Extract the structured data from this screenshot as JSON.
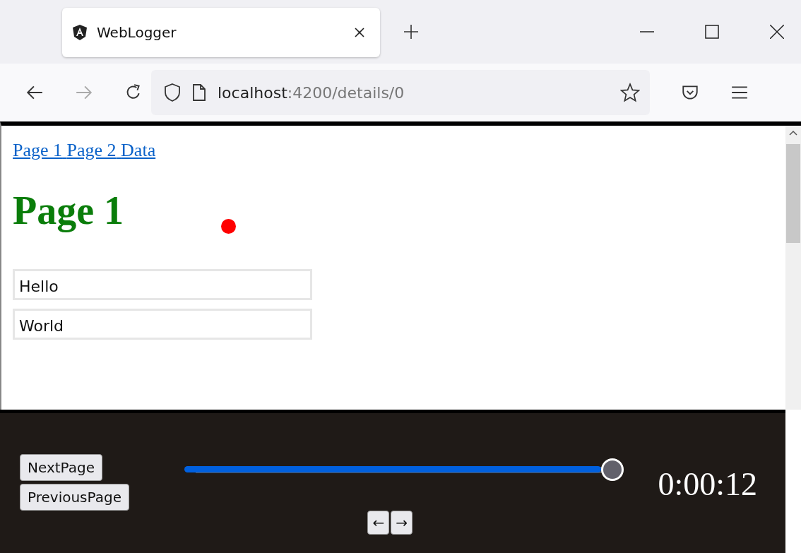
{
  "tab": {
    "title": "WebLogger"
  },
  "address": {
    "host": "localhost",
    "path": ":4200/details/0"
  },
  "nav_links": [
    {
      "label": "Page 1"
    },
    {
      "label": "Page 2"
    },
    {
      "label": "Data"
    }
  ],
  "heading": "Page 1",
  "fields": [
    {
      "value": "Hello"
    },
    {
      "value": "World"
    }
  ],
  "player": {
    "buttons": [
      "NextPage",
      "PreviousPage"
    ],
    "level": 1,
    "time": "0:00:12",
    "step_buttons": [
      "←",
      "→"
    ]
  }
}
